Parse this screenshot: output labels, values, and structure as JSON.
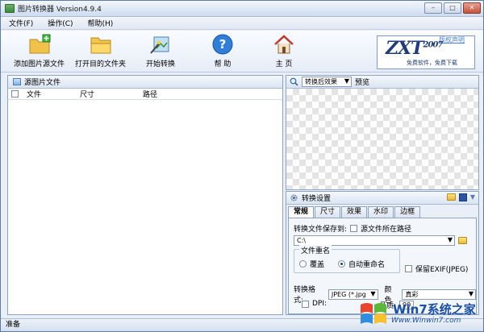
{
  "window": {
    "title": "图片转换器 Version4.9.4"
  },
  "menu": [
    {
      "label": "文件(F)"
    },
    {
      "label": "操作(C)"
    },
    {
      "label": "帮助(H)"
    }
  ],
  "toolbar": {
    "add_label": "添加图片源文件",
    "open_label": "打开目的文件夹",
    "start_label": "开始转换",
    "help_label": "帮 助",
    "home_label": "主 页"
  },
  "logo": {
    "link_text": "版权声明",
    "brand": "ZXT",
    "year": "2007",
    "slogan": "免费软件，免费下载"
  },
  "left_panel": {
    "title": "源图片文件",
    "columns": [
      "文件",
      "尺寸",
      "路径"
    ]
  },
  "preview": {
    "select_value": "转换后效果",
    "label": "预览"
  },
  "settings": {
    "title": "转换设置",
    "tabs": [
      "常规",
      "尺寸",
      "效果",
      "水印",
      "边框"
    ],
    "save_to_label": "转换文件保存到:",
    "source_path_label": "源文件所在路径",
    "path_value": "C:\\",
    "rename_group_title": "文件重名",
    "overwrite_label": "覆盖",
    "autorename_label": "自动重命名",
    "keep_exif_label": "保留EXIF(JPEG)",
    "format_label": "转换格式:",
    "format_value": "JPEG (*.jpg",
    "color_label": "颜色",
    "color_value": "真彩",
    "dpi_label": "DPI:",
    "quality_label": "品质:",
    "quality_value": "90"
  },
  "status": {
    "text": "准备"
  },
  "watermark": {
    "text": "Win7系统之家",
    "url": "Www.Winwin7.com"
  }
}
